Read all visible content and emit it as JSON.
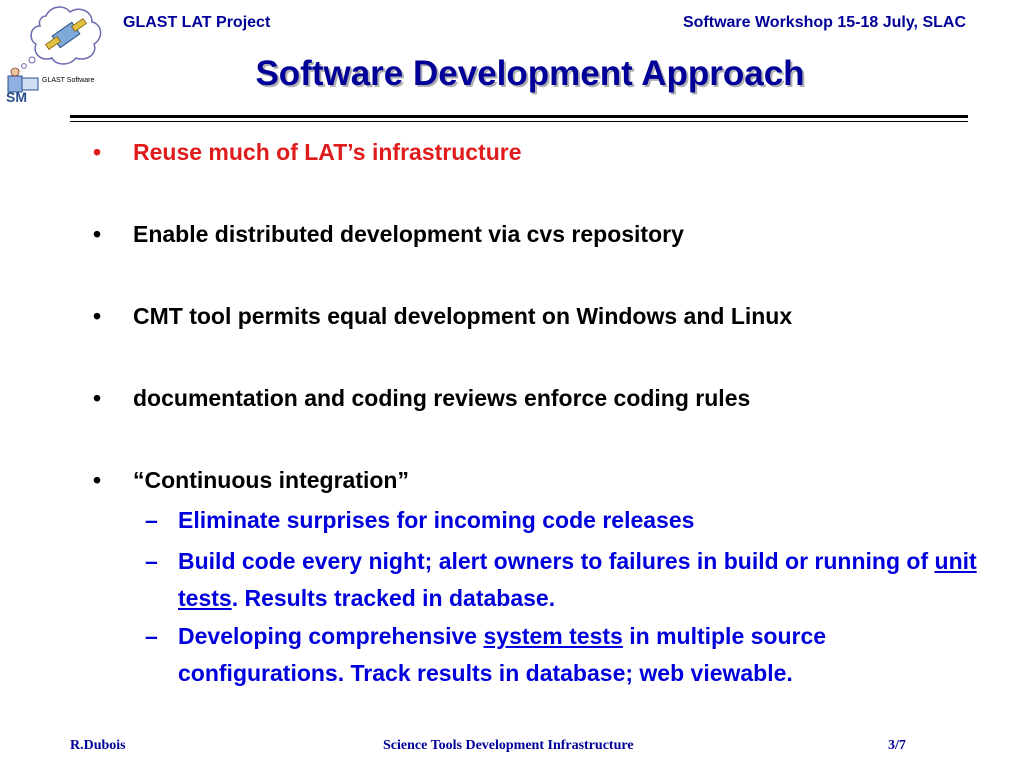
{
  "header": {
    "project": "GLAST LAT Project",
    "event": "Software Workshop 15-18 July, SLAC",
    "logo_text": "GLAST Software"
  },
  "title": "Software Development Approach",
  "bullets": [
    {
      "text": "Reuse much of LAT’s infrastructure",
      "highlight": true
    },
    {
      "text": "Enable distributed development via cvs repository"
    },
    {
      "text": "CMT tool permits equal development on Windows and Linux"
    },
    {
      "text": "documentation and coding reviews enforce coding rules"
    },
    {
      "text": "“Continuous integration”"
    }
  ],
  "subbullets": [
    {
      "text": "Eliminate surprises for incoming code releases"
    },
    {
      "pre": "Build code every night; alert owners to failures in build or running of ",
      "link": "unit tests",
      "post": ". Results tracked in database."
    },
    {
      "pre": "Developing comprehensive ",
      "link": "system tests",
      "post": " in multiple source configurations. Track results in database; web viewable."
    }
  ],
  "bullet_glyph": "•",
  "dash_glyph": "–",
  "footer": {
    "author": "R.Dubois",
    "talk": "Science Tools Development Infrastructure",
    "page": "3/7"
  },
  "colors": {
    "heading": "#000099",
    "highlight": "#e01b1b",
    "sub_text": "#0000dd"
  }
}
